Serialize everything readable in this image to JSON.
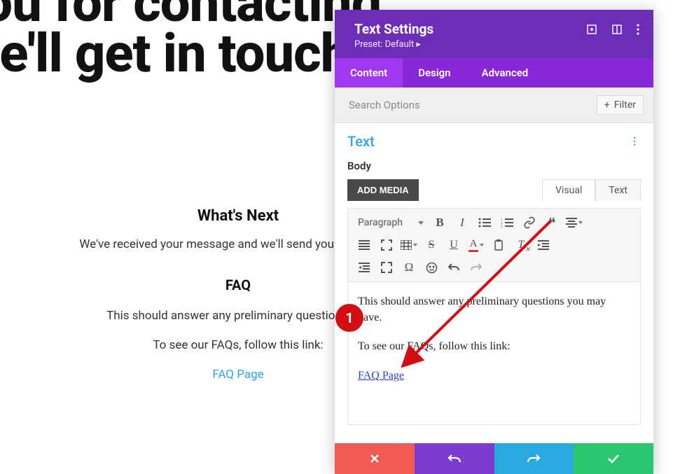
{
  "page": {
    "hero": "k you for contacting us. e'll get in touch",
    "whats_next_heading": "What's Next",
    "whats_next_body": "We've received your message and we'll send you an email wi",
    "faq_heading": "FAQ",
    "faq_body": "This should answer any preliminary questions you",
    "faq_link_intro": "To see our FAQs, follow this link:",
    "faq_link_text": "FAQ Page"
  },
  "panel": {
    "title": "Text Settings",
    "preset": "Preset: Default ▸",
    "tabs": {
      "content": "Content",
      "design": "Design",
      "advanced": "Advanced"
    },
    "search_placeholder": "Search Options",
    "filter_label": "Filter",
    "section_title": "Text",
    "body_label": "Body",
    "add_media": "ADD MEDIA",
    "mode_visual": "Visual",
    "mode_text": "Text",
    "paragraph_label": "Paragraph"
  },
  "editor": {
    "p1": "This should answer any preliminary questions you may have.",
    "p2": "To see our FAQs, follow this link:",
    "link_text": "FAQ Page"
  },
  "annotation": {
    "badge": "1"
  }
}
